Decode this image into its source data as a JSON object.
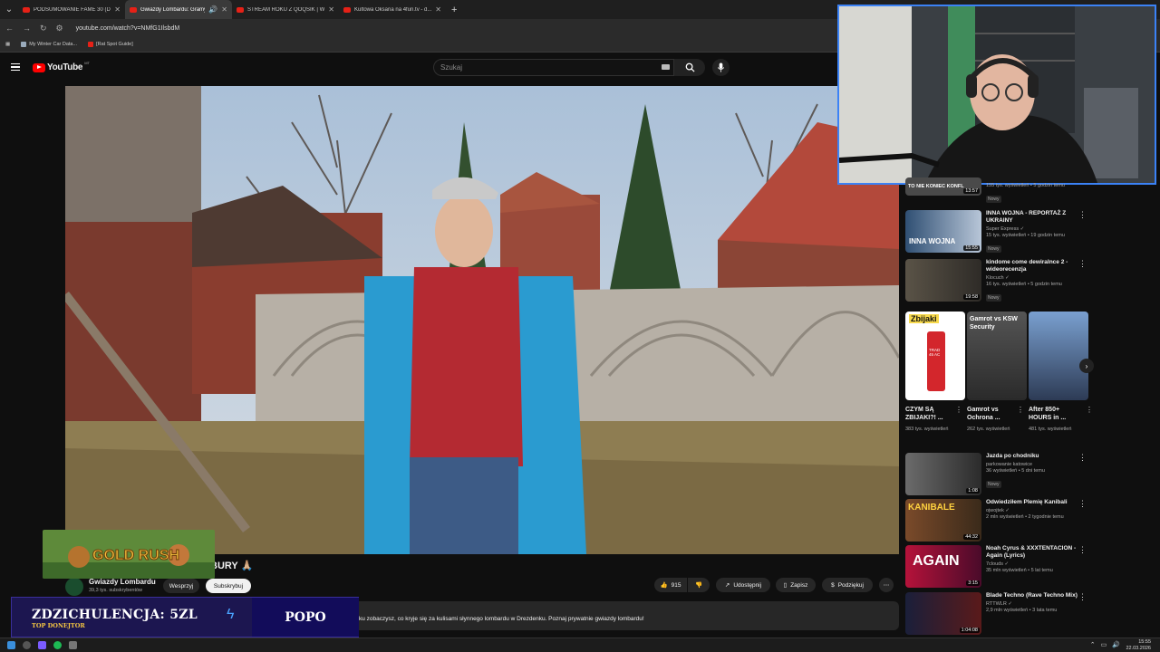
{
  "browser": {
    "tabs": [
      {
        "title": "PODSUMOWANIE FAME 30 (D..."
      },
      {
        "title": "Gwiazdy Lombardu: Gramy"
      },
      {
        "title": "STREAM ROKU Z QOQSIK | W..."
      },
      {
        "title": "Kultowa Oksana na 4fun.tv - d..."
      }
    ],
    "url": "youtube.com/watch?v=NMfG1IlsbdM",
    "bookmarks": [
      "My Winter Car Data...",
      "[Rat Spot Guide]"
    ]
  },
  "youtube": {
    "logo": "YouTube",
    "region": "MT",
    "search_placeholder": "Szukaj"
  },
  "video": {
    "title_visible": "BURY 🙏🏼",
    "channel": "Gwiazdy Lombardu",
    "subscribers": "39,3 tys. subskrybentów",
    "support_label": "Wesprzyj",
    "subscribe_label": "Subskrybuj",
    "likes": "915",
    "share_label": "Udostępnij",
    "save_label": "Zapisz",
    "thanks_label": "Podziękuj",
    "description": "ku zobaczysz, co kryje się za kulisami słynnego lombardu w Drezdenku. Poznaj prywatnie gwiazdy lombardu!"
  },
  "recommendations_top": [
    {
      "title": "",
      "channel": "",
      "views": "155 tys. wyświetleń • 5 godzin temu",
      "duration": "13:57",
      "badge": "Nowy",
      "thumb_text": "TO NIE KONIEC KONFL"
    },
    {
      "title": "INNA WOJNA - REPORTAŻ Z UKRAINY",
      "channel": "Super Express ✓",
      "views": "15 tys. wyświetleń • 19 godzin temu",
      "duration": "15:55",
      "badge": "Nowy",
      "thumb_text": "INNA WOJNA"
    },
    {
      "title": "kindome come dewiralnce 2 - wideorecenzja",
      "channel": "Klocuch ✓",
      "views": "16 tys. wyświetleń • 5 godzin temu",
      "duration": "19:58",
      "badge": "Nowy",
      "thumb_text": ""
    }
  ],
  "shorts": [
    {
      "title": "CZYM SĄ ZBIJAKI?! ...",
      "views": "383 tys. wyświetleń",
      "thumb_text": "Zbijaki",
      "thumb_sub": "TRAD 45 AC"
    },
    {
      "title": "Gamrot vs Ochrona ...",
      "views": "262 tys. wyświetleń",
      "thumb_text": "Gamrot vs KSW Security"
    },
    {
      "title": "After 850+ HOURS in ...",
      "views": "481 tys. wyświetleń",
      "thumb_text": ""
    }
  ],
  "recommendations_bottom": [
    {
      "title": "Jazda po chodniku",
      "channel": "parkowanie katowice",
      "views": "36 wyświetleń • 5 dni temu",
      "duration": "1:08",
      "badge": "Nowy",
      "thumb_text": ""
    },
    {
      "title": "Odwiedziłem Plemię Kanibali",
      "channel": "ojwojtek ✓",
      "views": "2 mln wyświetleń • 2 tygodnie temu",
      "duration": "44:32",
      "badge": "",
      "thumb_text": "KANIBALE"
    },
    {
      "title": "Noah Cyrus & XXXTENTACION - Again (Lyrics)",
      "channel": "7clouds ✓",
      "views": "35 mln wyświetleń • 5 lat temu",
      "duration": "3:15",
      "badge": "",
      "thumb_text": "AGAIN"
    },
    {
      "title": "Blade Techno (Rave Techno Mix)",
      "channel": "RTTWLR ✓",
      "views": "2,9 mln wyświetleń • 3 lata temu",
      "duration": "1:04:08",
      "badge": "",
      "thumb_text": ""
    }
  ],
  "overlay": {
    "game_banner": "GOLD RUSH",
    "donor_name": "ZDZICHULENCJA: 5ZL",
    "donor_subtitle": "TOP DONEJTOR",
    "donor_right": "POPO"
  },
  "taskbar": {
    "time": "15:55",
    "date": "22.03.2026"
  },
  "colors": {
    "youtube_red": "#ff0000",
    "webcam_border": "#3b82f6",
    "donor_bg": "#1c1650",
    "donor_gold": "#f4c542"
  }
}
